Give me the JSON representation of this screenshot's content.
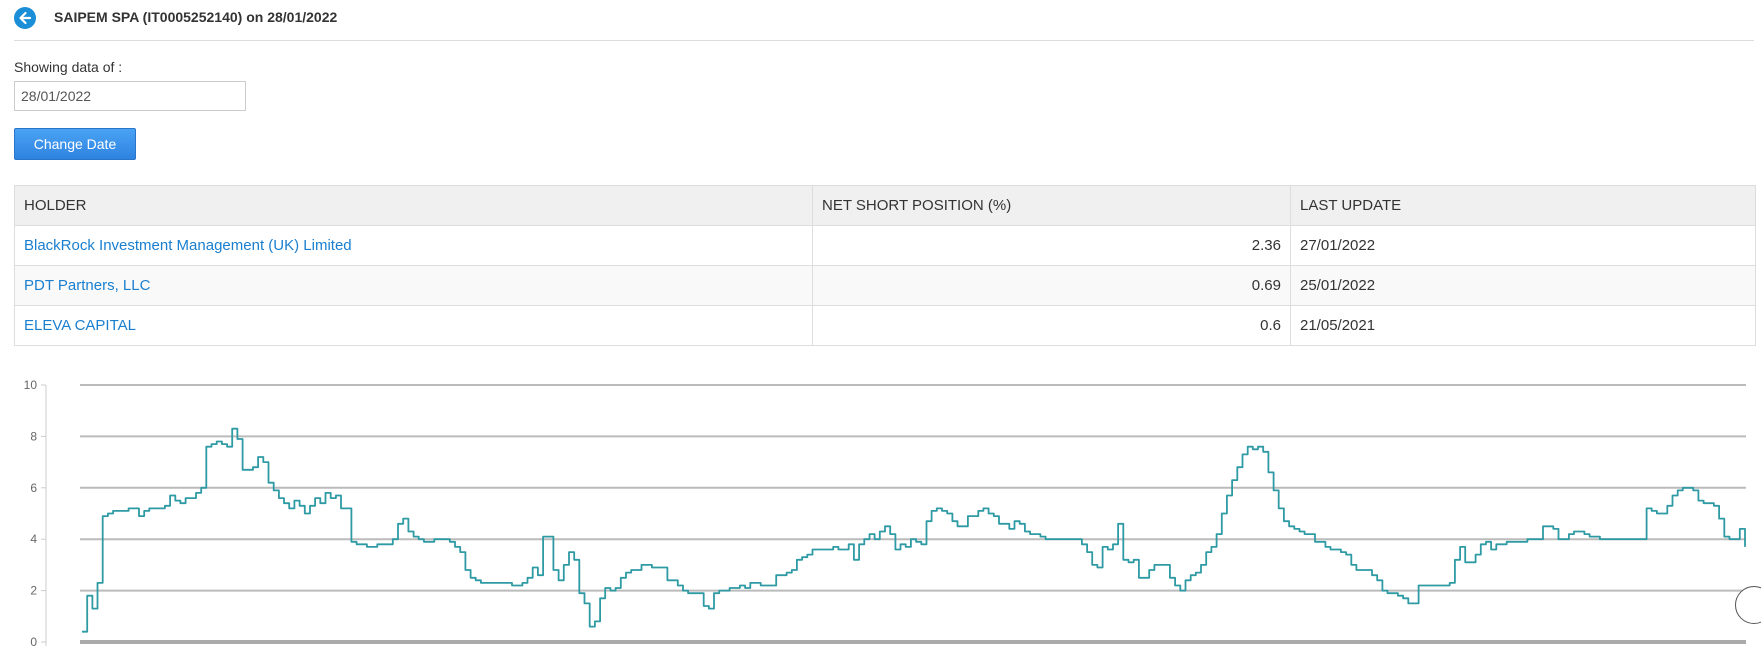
{
  "header": {
    "title": "SAIPEM SPA (IT0005252140) on 28/01/2022"
  },
  "date_form": {
    "label": "Showing data of :",
    "value": "28/01/2022",
    "button_label": "Change Date"
  },
  "table": {
    "columns": [
      "HOLDER",
      "NET SHORT POSITION (%)",
      "LAST UPDATE"
    ],
    "rows": [
      {
        "holder": "BlackRock Investment Management (UK) Limited",
        "position": "2.36",
        "date": "27/01/2022"
      },
      {
        "holder": "PDT Partners, LLC",
        "position": "0.69",
        "date": "25/01/2022"
      },
      {
        "holder": "ELEVA CAPITAL",
        "position": "0.6",
        "date": "21/05/2021"
      }
    ]
  },
  "colors": {
    "accent": "#1a8fd8",
    "link": "#1a7fcf",
    "line": "#2e9aa4",
    "grid": "#bbbbbb"
  },
  "chart_data": {
    "type": "line",
    "ylim": [
      0,
      10
    ],
    "yticks": [
      "0",
      "2",
      "4",
      "6",
      "8",
      "10"
    ],
    "grid": true,
    "series": [
      {
        "values": [
          0.4,
          1.8,
          1.3,
          2.3,
          4.9,
          5.0,
          5.1,
          5.1,
          5.1,
          5.2,
          5.2,
          4.9,
          5.1,
          5.2,
          5.2,
          5.2,
          5.3,
          5.7,
          5.5,
          5.4,
          5.6,
          5.6,
          5.8,
          6.0,
          7.6,
          7.7,
          7.8,
          7.7,
          7.6,
          8.3,
          7.9,
          6.7,
          6.7,
          6.8,
          7.2,
          7.0,
          6.2,
          5.9,
          5.6,
          5.4,
          5.2,
          5.5,
          5.3,
          5.0,
          5.3,
          5.6,
          5.4,
          5.8,
          5.6,
          5.7,
          5.2,
          5.2,
          3.9,
          3.8,
          3.8,
          3.7,
          3.7,
          3.8,
          3.8,
          3.8,
          4.0,
          4.6,
          4.8,
          4.3,
          4.1,
          4.0,
          3.9,
          3.9,
          4.0,
          4.0,
          4.0,
          3.9,
          3.7,
          3.5,
          2.8,
          2.5,
          2.4,
          2.3,
          2.3,
          2.3,
          2.3,
          2.3,
          2.3,
          2.2,
          2.2,
          2.3,
          2.5,
          2.9,
          2.6,
          4.1,
          4.1,
          2.8,
          2.4,
          3.0,
          3.5,
          3.2,
          1.9,
          1.5,
          0.6,
          0.8,
          1.7,
          2.1,
          2.0,
          2.1,
          2.5,
          2.7,
          2.8,
          2.8,
          3.0,
          3.0,
          2.9,
          2.9,
          2.9,
          2.4,
          2.4,
          2.2,
          2.0,
          1.9,
          1.9,
          1.9,
          1.4,
          1.3,
          1.9,
          2.0,
          2.0,
          2.1,
          2.1,
          2.2,
          2.1,
          2.3,
          2.3,
          2.2,
          2.2,
          2.2,
          2.6,
          2.6,
          2.7,
          2.8,
          3.2,
          3.3,
          3.4,
          3.6,
          3.6,
          3.6,
          3.6,
          3.7,
          3.6,
          3.6,
          3.8,
          3.2,
          3.8,
          4.0,
          4.2,
          4.0,
          4.3,
          4.5,
          4.2,
          3.6,
          3.8,
          3.7,
          4.0,
          3.9,
          3.8,
          4.7,
          5.1,
          5.2,
          5.1,
          5.0,
          4.7,
          4.5,
          4.5,
          4.9,
          4.9,
          5.1,
          5.2,
          5.0,
          4.9,
          4.6,
          4.6,
          4.4,
          4.7,
          4.6,
          4.3,
          4.2,
          4.2,
          4.1,
          4.0,
          4.0,
          4.0,
          4.0,
          4.0,
          4.0,
          4.0,
          3.8,
          3.5,
          3.0,
          2.9,
          3.7,
          3.6,
          3.8,
          4.6,
          3.2,
          3.1,
          3.2,
          2.5,
          2.5,
          2.8,
          3.0,
          3.0,
          3.0,
          2.5,
          2.2,
          2.0,
          2.4,
          2.6,
          2.7,
          3.0,
          3.5,
          3.7,
          4.2,
          5.0,
          5.7,
          6.3,
          6.8,
          7.3,
          7.6,
          7.5,
          7.6,
          7.4,
          6.6,
          5.9,
          5.2,
          4.7,
          4.5,
          4.4,
          4.3,
          4.2,
          4.2,
          3.9,
          3.9,
          3.7,
          3.6,
          3.6,
          3.5,
          3.4,
          3.0,
          2.8,
          2.8,
          2.8,
          2.6,
          2.4,
          2.0,
          1.9,
          1.9,
          1.8,
          1.7,
          1.5,
          1.5,
          2.2,
          2.2,
          2.2,
          2.2,
          2.2,
          2.2,
          2.3,
          3.2,
          3.7,
          3.1,
          3.1,
          3.4,
          3.8,
          3.9,
          3.6,
          3.8,
          3.8,
          3.9,
          3.9,
          3.9,
          3.9,
          4.0,
          4.0,
          4.0,
          4.5,
          4.5,
          4.4,
          4.0,
          4.0,
          4.2,
          4.3,
          4.3,
          4.2,
          4.1,
          4.1,
          4.0,
          4.0,
          4.0,
          4.0,
          4.0,
          4.0,
          4.0,
          4.0,
          4.0,
          5.2,
          5.1,
          5.0,
          5.0,
          5.3,
          5.7,
          5.9,
          6.0,
          6.0,
          5.9,
          5.5,
          5.4,
          5.4,
          5.3,
          4.8,
          4.1,
          4.0,
          4.0,
          4.4,
          3.7
        ]
      }
    ]
  }
}
